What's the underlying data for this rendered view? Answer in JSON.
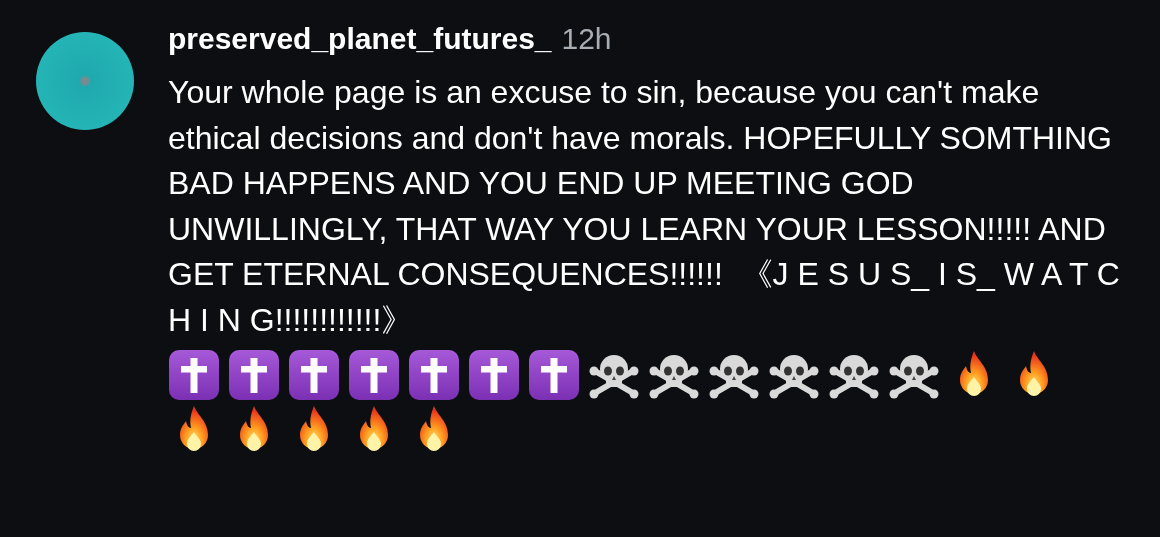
{
  "comment": {
    "username": "preserved_planet_futures_",
    "time": "12h",
    "text": "Your whole page is an excuse to sin, because you can't make ethical decisions and don't have morals. HOPEFULLY SOMTHING BAD HAPPENS AND YOU END UP MEETING GOD UNWILLINGLY, THAT WAY YOU LEARN YOUR LESSON!!!!! AND GET ETERNAL CONSEQUENCES!!!!!!  《J E S U S_ I S_ W A T C H I N G!!!!!!!!!!!!》",
    "emojis": [
      {
        "kind": "cross"
      },
      {
        "kind": "cross"
      },
      {
        "kind": "cross"
      },
      {
        "kind": "cross"
      },
      {
        "kind": "cross"
      },
      {
        "kind": "cross"
      },
      {
        "kind": "cross"
      },
      {
        "kind": "skull"
      },
      {
        "kind": "skull"
      },
      {
        "kind": "skull"
      },
      {
        "kind": "skull"
      },
      {
        "kind": "skull"
      },
      {
        "kind": "skull"
      },
      {
        "kind": "fire"
      },
      {
        "kind": "fire"
      },
      {
        "kind": "fire"
      },
      {
        "kind": "fire"
      },
      {
        "kind": "fire"
      },
      {
        "kind": "fire"
      },
      {
        "kind": "fire"
      }
    ]
  }
}
